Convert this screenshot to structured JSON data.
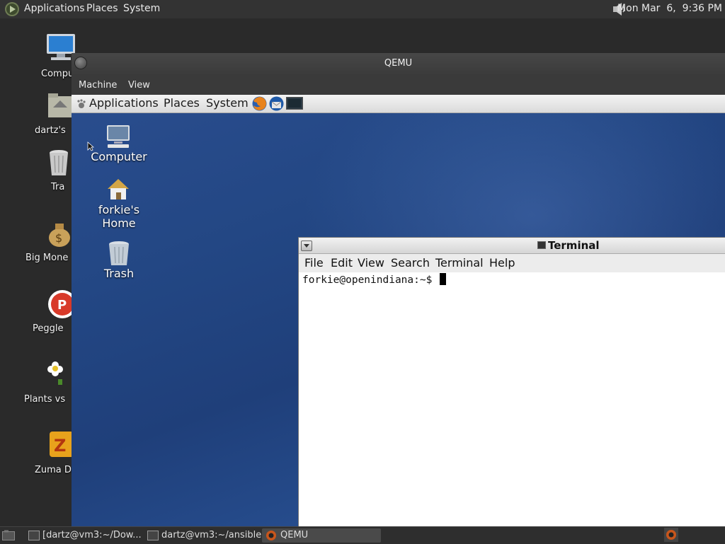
{
  "host_panel": {
    "menus": [
      "Applications",
      "Places",
      "System"
    ],
    "clock": "Mon Mar  6,  9:36 PM",
    "volume_icon": "speaker-icon"
  },
  "host_desktop_icons": [
    {
      "label": "Compu",
      "icon": "computer-icon"
    },
    {
      "label": "dartz's",
      "icon": "home-folder-icon"
    },
    {
      "label": "Tra",
      "icon": "trash-icon"
    },
    {
      "label": "Big Mone",
      "icon": "money-bag-icon"
    },
    {
      "label": "Peggle",
      "icon": "peggle-icon"
    },
    {
      "label": "Plants vs",
      "icon": "flower-icon"
    },
    {
      "label": "Zuma De",
      "icon": "zuma-icon"
    }
  ],
  "qemu": {
    "title": "QEMU",
    "menus": [
      "Machine",
      "View"
    ]
  },
  "guest": {
    "panel_menus": [
      "Applications",
      "Places",
      "System"
    ],
    "launchers": [
      "firefox-icon",
      "thunderbird-icon",
      "terminal-icon"
    ],
    "desktop_icons": [
      {
        "label": "Computer",
        "icon": "computer-icon"
      },
      {
        "label": "forkie's\nHome",
        "icon": "home-icon"
      },
      {
        "label": "Trash",
        "icon": "trash-icon"
      }
    ],
    "terminal": {
      "title": "Terminal",
      "menus": [
        "File",
        "Edit",
        "View",
        "Search",
        "Terminal",
        "Help"
      ],
      "prompt": "forkie@openindiana:~$ "
    }
  },
  "taskbar": {
    "tasks": [
      {
        "label": "[dartz@vm3:~/Dow...",
        "icon": "terminal-icon"
      },
      {
        "label": "dartz@vm3:~/ansible",
        "icon": "terminal-icon"
      },
      {
        "label": "QEMU",
        "icon": "qemu-icon"
      }
    ]
  }
}
